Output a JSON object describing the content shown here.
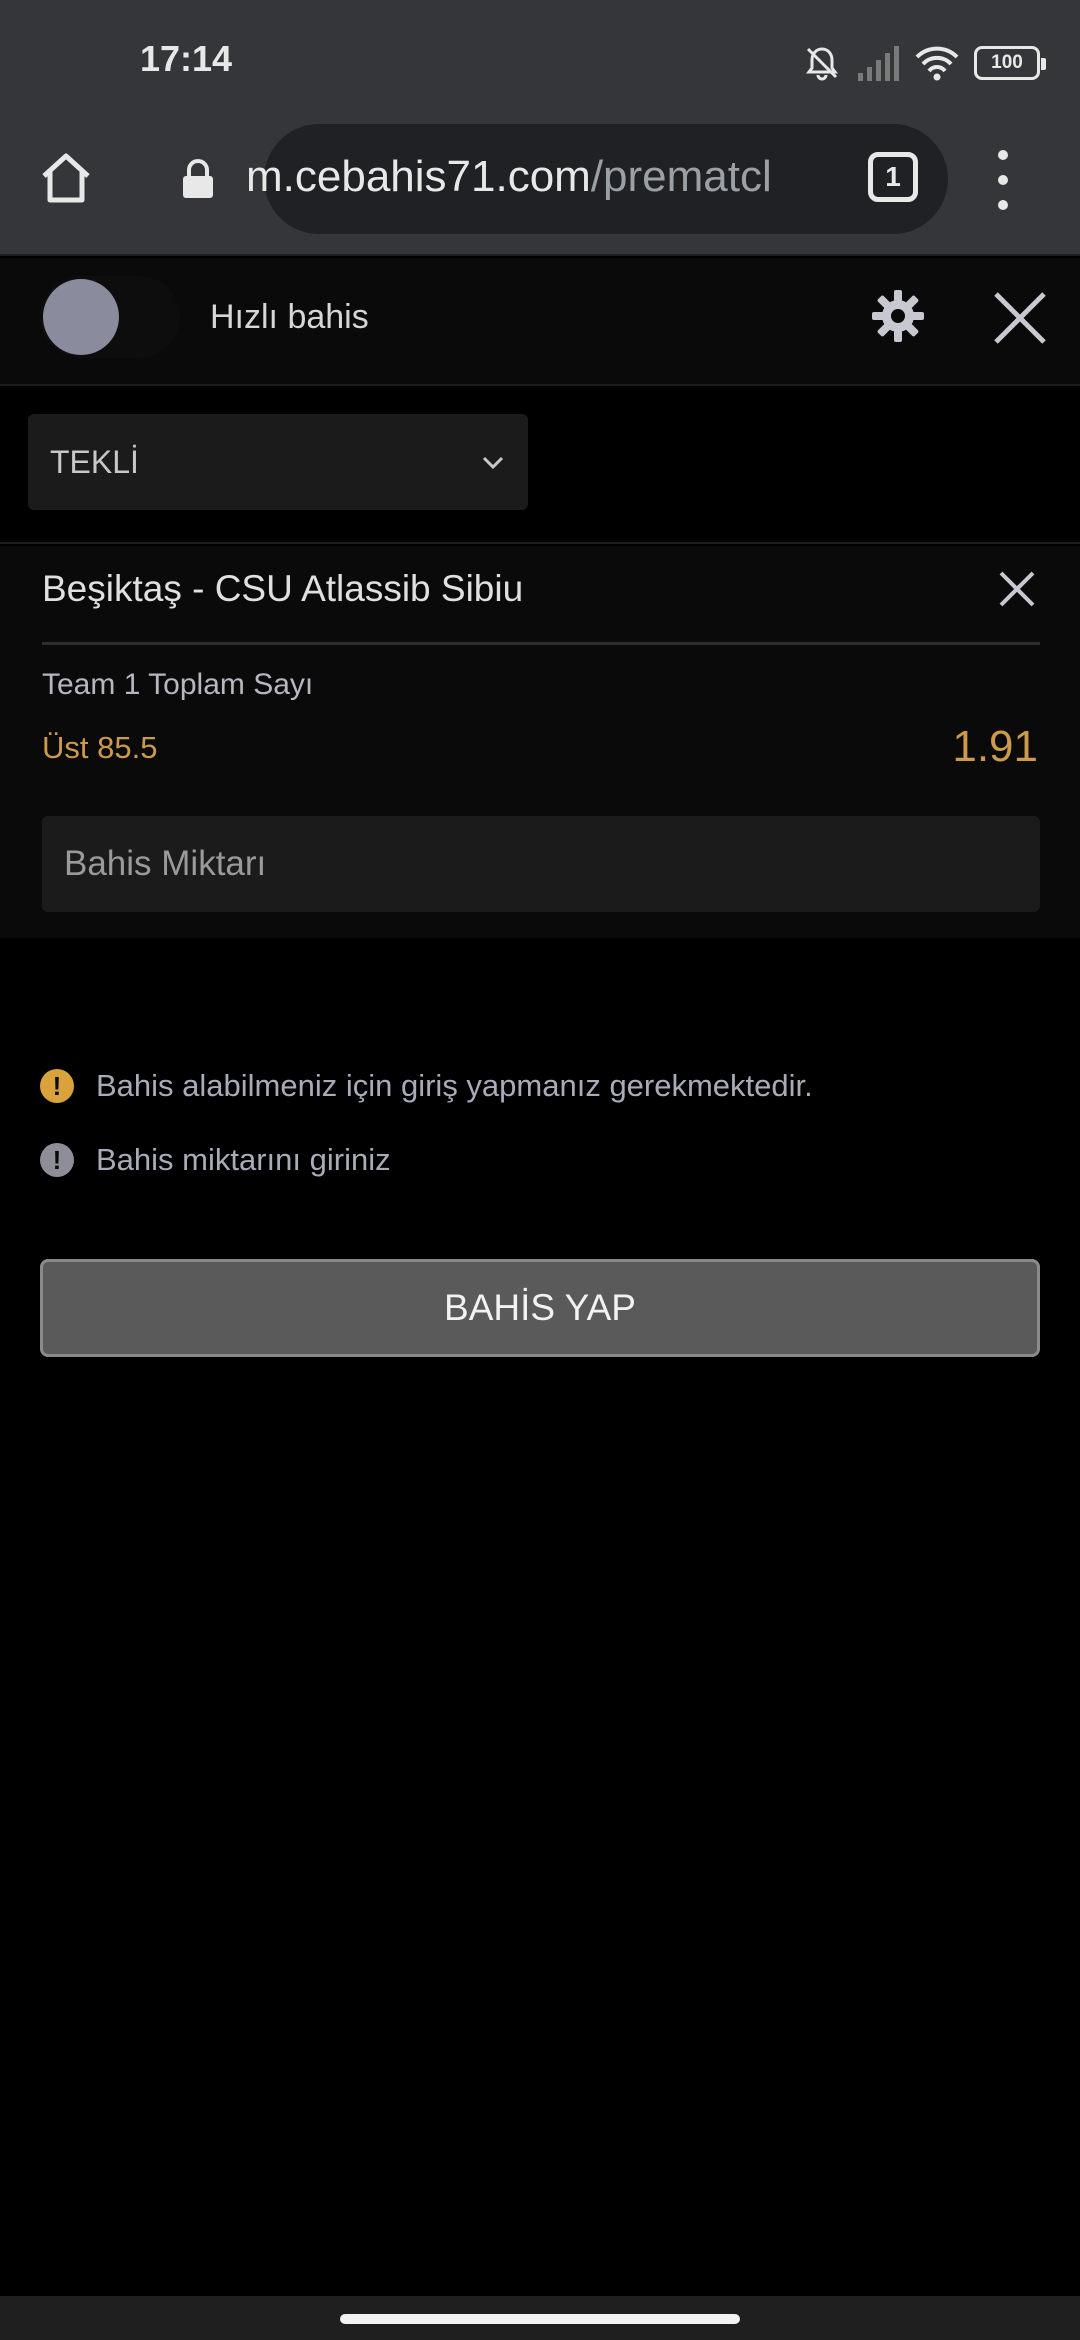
{
  "status_bar": {
    "time": "17:14",
    "battery": "100",
    "icons": [
      "mute-bell-icon",
      "signal-icon",
      "wifi-icon",
      "battery-icon"
    ]
  },
  "browser": {
    "url_host": "m.cebahis71.com",
    "url_path": "/prematcl",
    "tab_count": "1",
    "icons": [
      "home-icon",
      "lock-icon",
      "menu-dots-icon"
    ]
  },
  "betslip": {
    "quick_bet_label": "Hızlı bahis",
    "quick_bet_enabled": false,
    "bet_type": "TEKLİ",
    "match": "Beşiktaş - CSU Atlassib Sibiu",
    "market": "Team 1 Toplam Sayı",
    "selection": "Üst 85.5",
    "odds": "1.91",
    "stake_placeholder": "Bahis Miktarı",
    "messages": {
      "login_required": "Bahis alabilmeniz için giriş yapmanız gerekmektedir.",
      "enter_amount": "Bahis miktarını giriniz"
    },
    "place_bet_label": "BAHİS YAP"
  },
  "colors": {
    "accent": "#cb9a4b",
    "warning": "#d9a23a",
    "background": "#000000",
    "toolbar": "#35363a"
  }
}
